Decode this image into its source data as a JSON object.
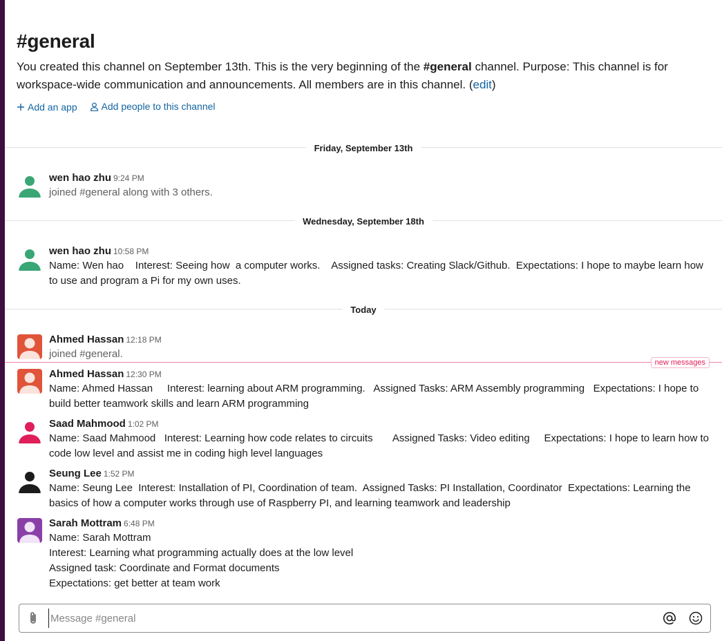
{
  "channel": {
    "title": "#general",
    "intro_prefix": "You created this channel on September 13th. This is the very beginning of the ",
    "intro_channel": "#general",
    "intro_suffix": " channel. Purpose: This channel is for workspace-wide communication and announcements. All members are in this channel. (",
    "intro_edit": "edit",
    "intro_close": ")",
    "actions": {
      "add_app": "Add an app",
      "add_people": "Add people to this channel"
    }
  },
  "days": {
    "d1": "Friday, September 13th",
    "d2": "Wednesday, September 18th",
    "d3": "Today"
  },
  "messages": {
    "m1": {
      "author": "wen hao zhu",
      "time": "9:24 PM",
      "text": "joined #general along with 3 others."
    },
    "m2": {
      "author": "wen hao zhu",
      "time": "10:58 PM",
      "text": "Name: Wen hao    Interest: Seeing how  a computer works.    Assigned tasks: Creating Slack/Github.  Expectations: I hope to maybe learn how to use and program a Pi for my own uses."
    },
    "m3": {
      "author": "Ahmed Hassan",
      "time": "12:18 PM",
      "text": "joined #general."
    },
    "m4": {
      "author": "Ahmed Hassan",
      "time": "12:30 PM",
      "text": "Name: Ahmed Hassan     Interest: learning about ARM programming.   Assigned Tasks: ARM Assembly programming   Expectations: I hope to build better teamwork skills and learn ARM programming"
    },
    "m5": {
      "author": "Saad Mahmood",
      "time": "1:02 PM",
      "text": "Name: Saad Mahmood   Interest: Learning how code relates to circuits       Assigned Tasks: Video editing     Expectations: I hope to learn how to code low level and assist me in coding high level languages"
    },
    "m6": {
      "author": "Seung Lee",
      "time": "1:52 PM",
      "text": "Name: Seung Lee  Interest: Installation of PI, Coordination of team.  Assigned Tasks: PI Installation, Coordinator  Expectations: Learning the basics of how a computer works through use of Raspberry PI, and learning teamwork and leadership"
    },
    "m7": {
      "author": "Sarah Mottram",
      "time": "6:48 PM",
      "text": "Name: Sarah Mottram\nInterest: Learning what programming actually does at the low level\nAssigned task: Coordinate and Format documents\nExpectations: get better at team work"
    }
  },
  "new_messages_label": "new messages",
  "composer": {
    "placeholder": "Message #general"
  },
  "colors": {
    "avatar_green": "#3aa675",
    "avatar_orange": "#e0543a",
    "avatar_pink": "#e01e5a",
    "avatar_black": "#1d1c1d",
    "avatar_purple": "#8a3fa8",
    "link": "#1264a3"
  },
  "icons": [
    "plus-icon",
    "person-icon",
    "paperclip-icon",
    "at-sign-icon",
    "emoji-icon"
  ]
}
